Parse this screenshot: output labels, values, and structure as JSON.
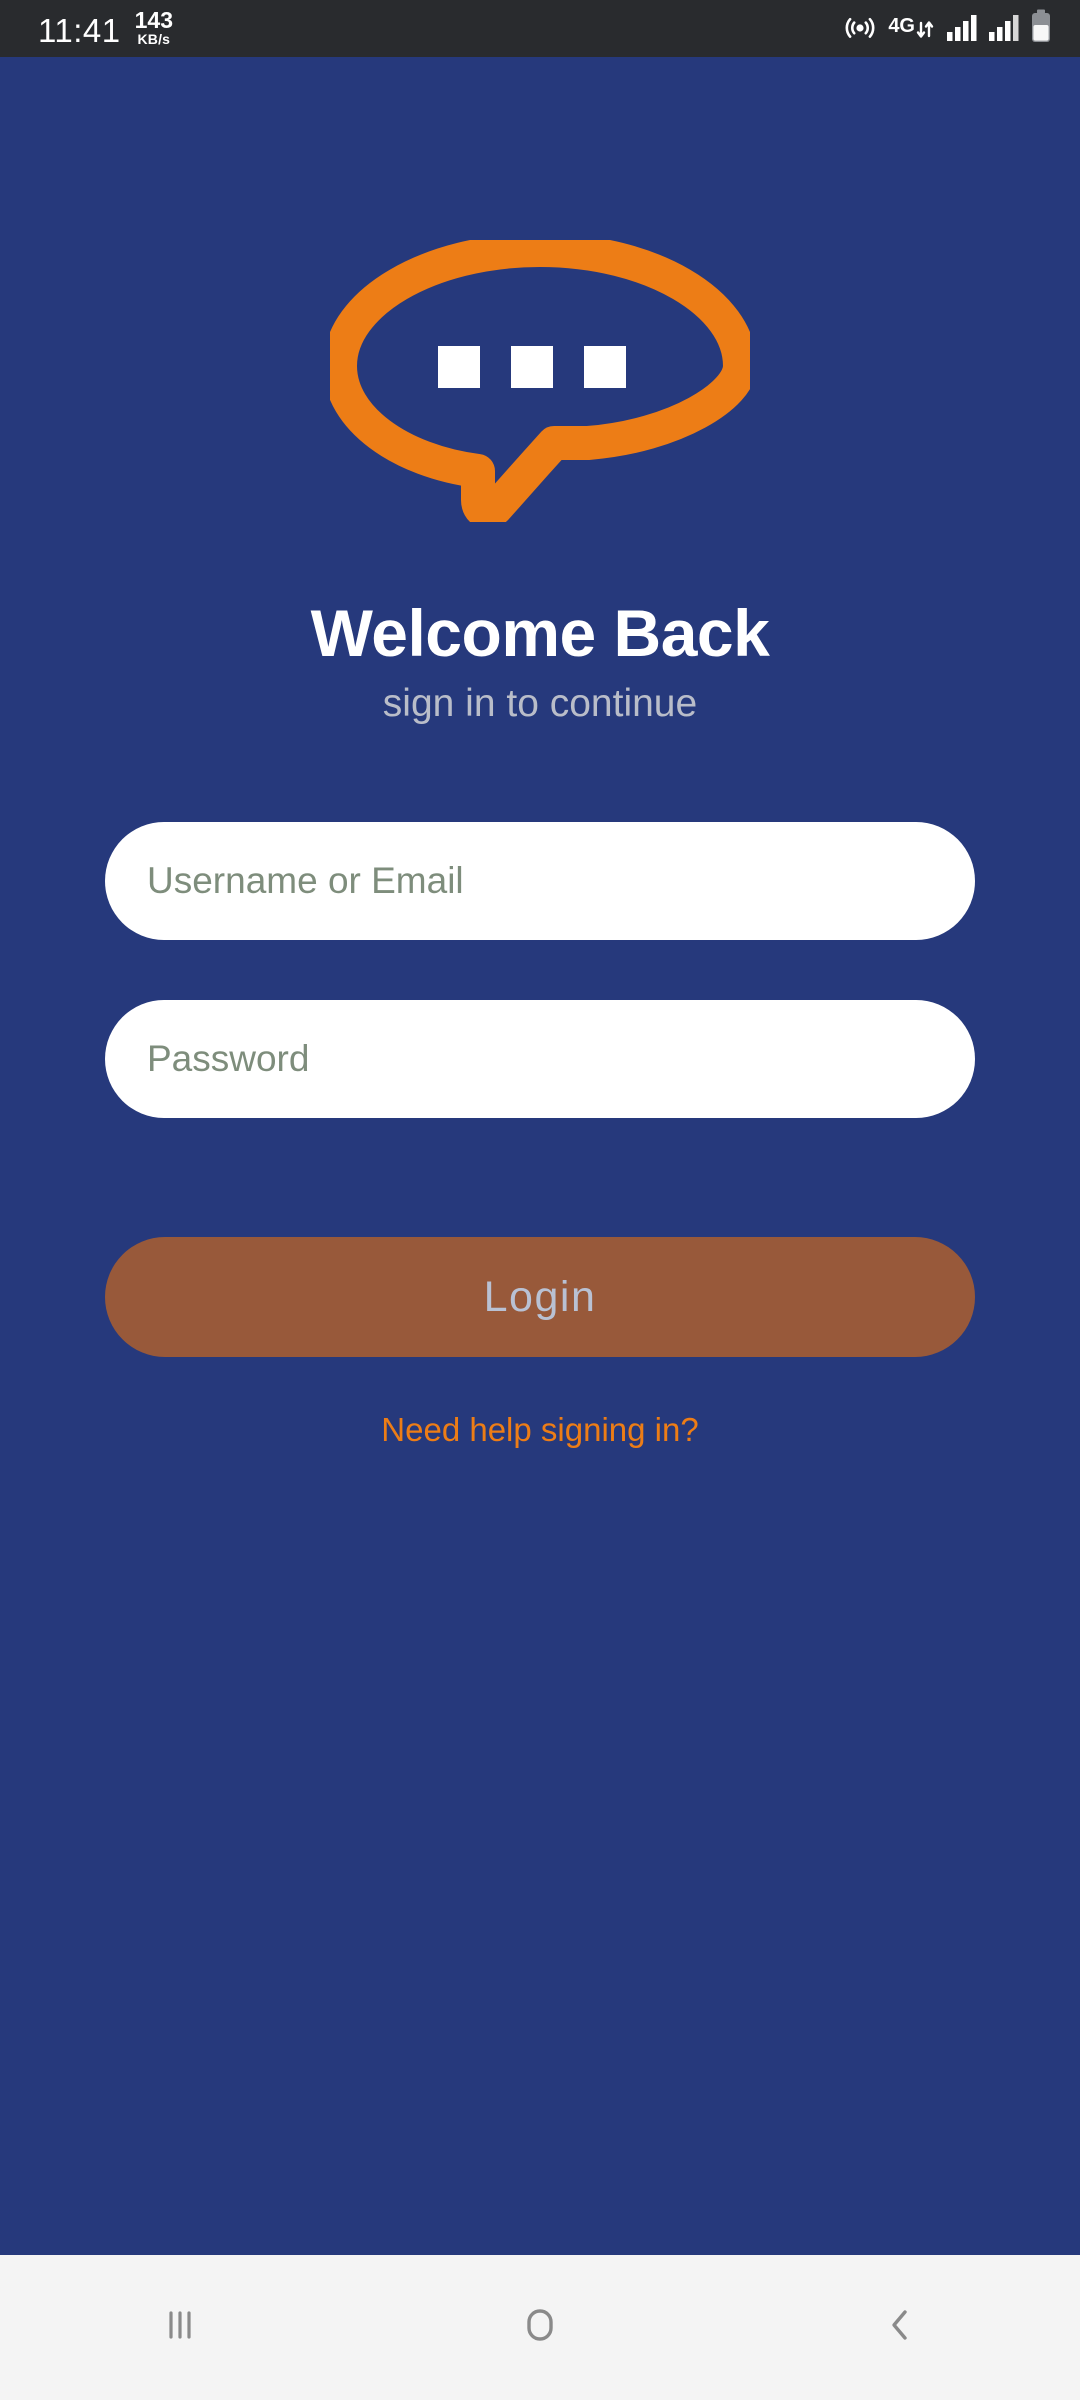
{
  "status_bar": {
    "time": "11:41",
    "net_speed_value": "143",
    "net_speed_unit": "KB/s",
    "icons": {
      "hotspot": "hotspot-icon",
      "network_type": "4G",
      "data_arrows": "data-transfer-arrows-icon",
      "signal_1": "signal-bars-sim1-icon",
      "signal_2": "signal-bars-sim2-icon",
      "battery": "battery-icon"
    },
    "background_color": "#292b2e",
    "text_color": "#ffffff"
  },
  "app": {
    "background_color": "#26397c",
    "accent_color": "#ed7d16",
    "logo": {
      "name": "chat-bubble-logo",
      "color": "#ed7d16",
      "dot_color": "#ffffff",
      "dot_count": 3
    },
    "title": "Welcome Back",
    "subtitle": "sign in to continue",
    "form": {
      "username_placeholder": "Username or Email",
      "username_value": "",
      "password_placeholder": "Password",
      "password_value": "",
      "placeholder_color": "#7e8d7c",
      "field_background": "#ffffff"
    },
    "login_button": {
      "label": "Login",
      "background_color": "#98593a",
      "text_color": "#b9c1d3",
      "enabled": false
    },
    "help_link": {
      "label": "Need help signing in?",
      "color": "#ed7d16"
    }
  },
  "nav_bar": {
    "background_color": "#f4f4f4",
    "icon_color": "#8a8a8a",
    "buttons": [
      {
        "name": "recents",
        "icon": "recents-icon"
      },
      {
        "name": "home",
        "icon": "home-icon"
      },
      {
        "name": "back",
        "icon": "back-chevron-icon"
      }
    ]
  }
}
